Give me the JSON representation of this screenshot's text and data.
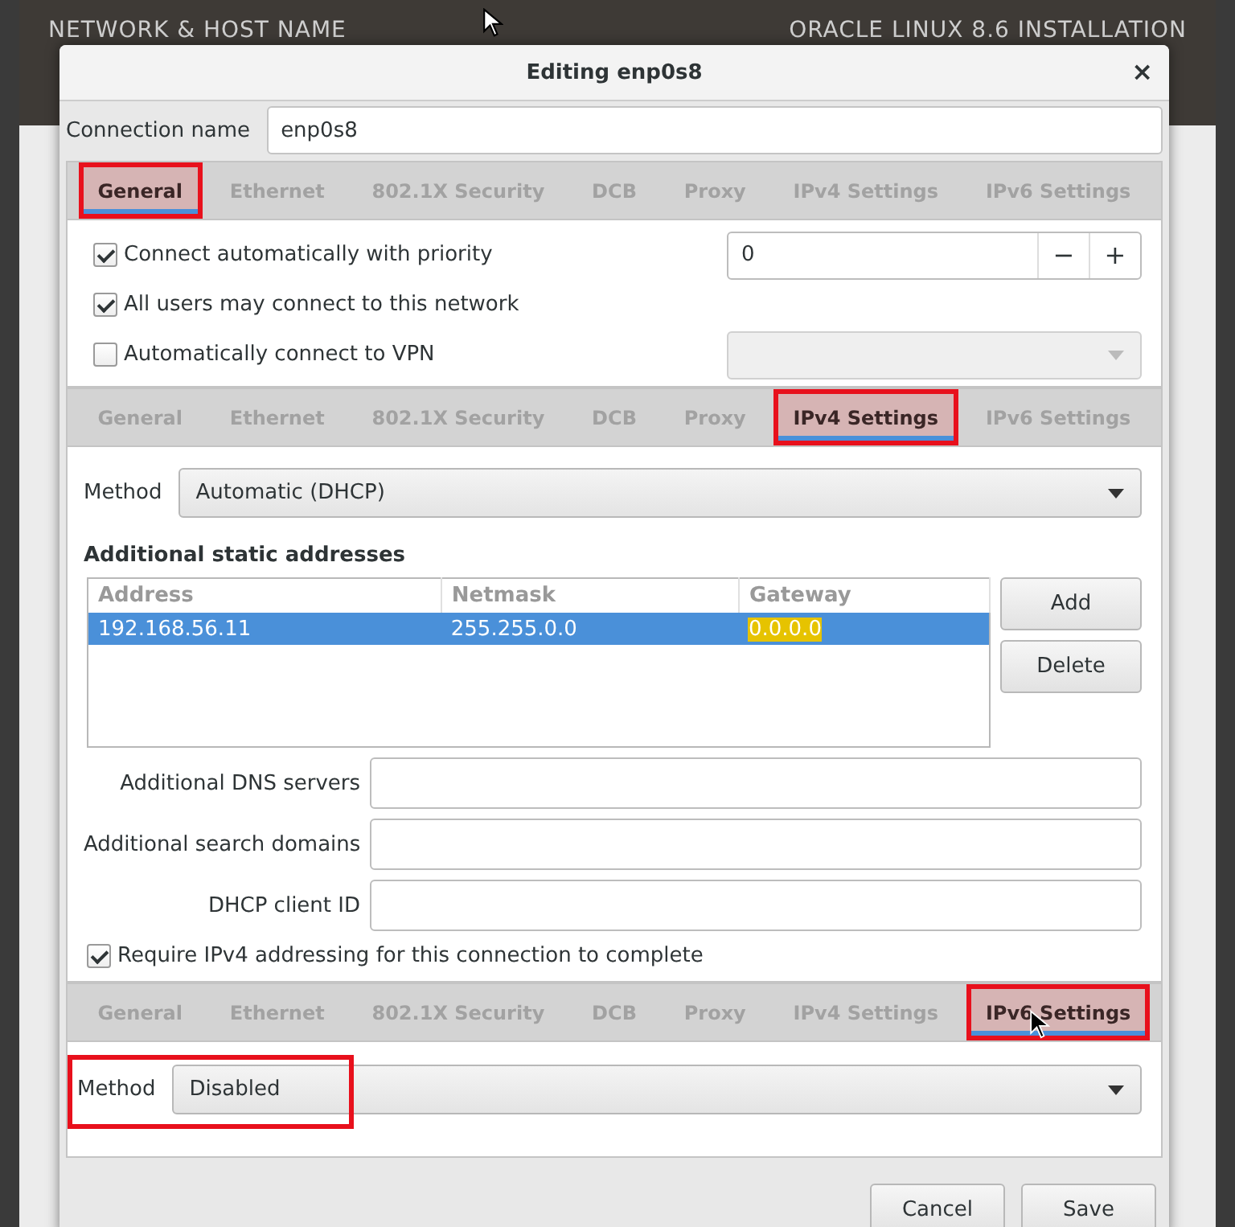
{
  "background": {
    "left_title": "NETWORK & HOST NAME",
    "right_title": "ORACLE LINUX 8.6 INSTALLATION"
  },
  "dialog": {
    "title": "Editing enp0s8",
    "close": "×"
  },
  "connection_name": {
    "label": "Connection name",
    "value": "enp0s8"
  },
  "sections": [
    {
      "kind": "general",
      "tabs": [
        {
          "label": "General",
          "selected": true,
          "highlighted": true
        },
        {
          "label": "Ethernet",
          "selected": false,
          "highlighted": false
        },
        {
          "label": "802.1X Security",
          "selected": false,
          "highlighted": false
        },
        {
          "label": "DCB",
          "selected": false,
          "highlighted": false
        },
        {
          "label": "Proxy",
          "selected": false,
          "highlighted": false
        },
        {
          "label": "IPv4 Settings",
          "selected": false,
          "highlighted": false
        },
        {
          "label": "IPv6 Settings",
          "selected": false,
          "highlighted": false
        }
      ],
      "options": [
        {
          "kind": "spin",
          "label": "Connect automatically with priority",
          "checked": true,
          "value": "0",
          "minus": "−",
          "plus": "+"
        },
        {
          "kind": "plain",
          "label": "All users may connect to this network",
          "checked": true
        },
        {
          "kind": "combo",
          "label": "Automatically connect to VPN",
          "checked": false
        }
      ]
    },
    {
      "kind": "ipv4",
      "tabs": [
        {
          "label": "General",
          "selected": false,
          "highlighted": false
        },
        {
          "label": "Ethernet",
          "selected": false,
          "highlighted": false
        },
        {
          "label": "802.1X Security",
          "selected": false,
          "highlighted": false
        },
        {
          "label": "DCB",
          "selected": false,
          "highlighted": false
        },
        {
          "label": "Proxy",
          "selected": false,
          "highlighted": false
        },
        {
          "label": "IPv4 Settings",
          "selected": true,
          "highlighted": true
        },
        {
          "label": "IPv6 Settings",
          "selected": false,
          "highlighted": false
        }
      ],
      "method": {
        "label": "Method",
        "value": "Automatic (DHCP)"
      },
      "addresses": {
        "title": "Additional static addresses",
        "columns": [
          "Address",
          "Netmask",
          "Gateway"
        ],
        "rows": [
          {
            "selected": true,
            "cells": [
              {
                "text": "192.168.56.11",
                "highlighted": false
              },
              {
                "text": "255.255.0.0",
                "highlighted": false
              },
              {
                "text": "0.0.0.0",
                "highlighted": true
              }
            ]
          }
        ],
        "buttons": [
          "Add",
          "Delete"
        ]
      },
      "fields": [
        {
          "label": "Additional DNS servers"
        },
        {
          "label": "Additional search domains"
        },
        {
          "label": "DHCP client ID"
        }
      ],
      "require": {
        "label": "Require IPv4 addressing for this connection to complete",
        "checked": true
      }
    },
    {
      "kind": "ipv6",
      "tabs": [
        {
          "label": "General",
          "selected": false,
          "highlighted": false
        },
        {
          "label": "Ethernet",
          "selected": false,
          "highlighted": false
        },
        {
          "label": "802.1X Security",
          "selected": false,
          "highlighted": false
        },
        {
          "label": "DCB",
          "selected": false,
          "highlighted": false
        },
        {
          "label": "Proxy",
          "selected": false,
          "highlighted": false
        },
        {
          "label": "IPv4 Settings",
          "selected": false,
          "highlighted": false
        },
        {
          "label": "IPv6 Settings",
          "selected": true,
          "highlighted": true
        }
      ],
      "method": {
        "label": "Method",
        "value": "Disabled",
        "highlighted": true
      }
    }
  ],
  "buttons": [
    "Cancel",
    "Save"
  ]
}
